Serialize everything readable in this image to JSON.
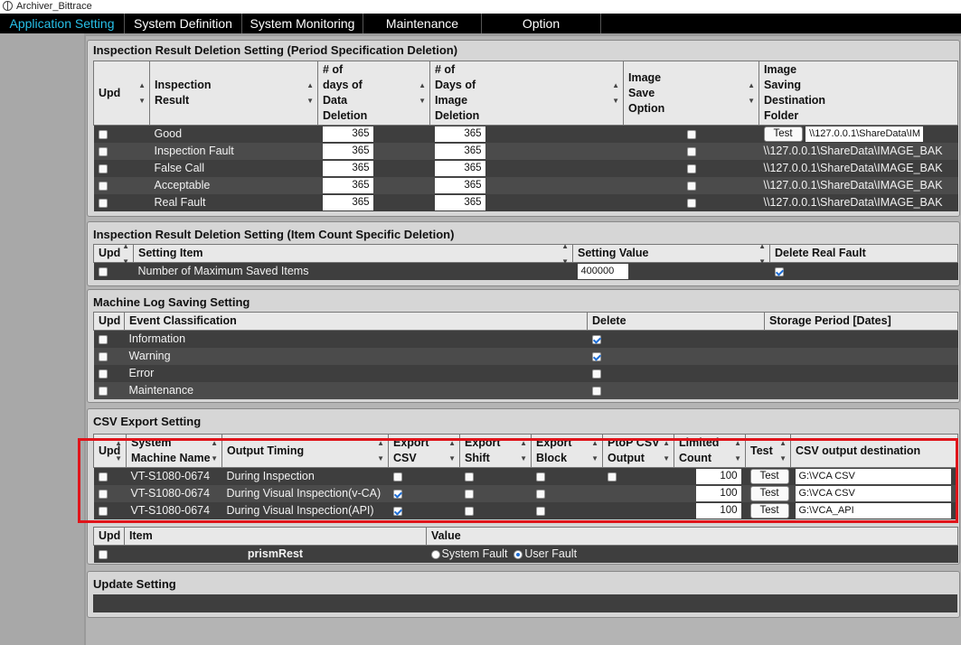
{
  "window": {
    "title": "Archiver_Bittrace"
  },
  "menu": [
    {
      "label": "Application Setting",
      "active": true
    },
    {
      "label": "System Definition"
    },
    {
      "label": "System Monitoring"
    },
    {
      "label": "Maintenance"
    },
    {
      "label": "Option"
    }
  ],
  "period_deletion": {
    "title": "Inspection Result Deletion Setting (Period Specification Deletion)",
    "headers": {
      "upd": "Upd",
      "result": "Inspection\nResult",
      "data_days": "# of\ndays of\nData\nDeletion",
      "image_days": "# of\nDays of\nImage\nDeletion",
      "image_save": "Image\nSave\nOption",
      "folder": "Image\nSaving\nDestination\nFolder"
    },
    "rows": [
      {
        "result": "Good",
        "data_days": "365",
        "image_days": "365",
        "test_label": "Test",
        "folder": "\\\\127.0.0.1\\ShareData\\IM"
      },
      {
        "result": "Inspection Fault",
        "data_days": "365",
        "image_days": "365",
        "folder": "\\\\127.0.0.1\\ShareData\\IMAGE_BAK"
      },
      {
        "result": "False Call",
        "data_days": "365",
        "image_days": "365",
        "folder": "\\\\127.0.0.1\\ShareData\\IMAGE_BAK"
      },
      {
        "result": "Acceptable",
        "data_days": "365",
        "image_days": "365",
        "folder": "\\\\127.0.0.1\\ShareData\\IMAGE_BAK"
      },
      {
        "result": "Real Fault",
        "data_days": "365",
        "image_days": "365",
        "folder": "\\\\127.0.0.1\\ShareData\\IMAGE_BAK"
      }
    ]
  },
  "count_deletion": {
    "title": "Inspection Result Deletion Setting (Item Count Specific Deletion)",
    "headers": {
      "upd": "Upd",
      "item": "Setting Item",
      "value": "Setting Value",
      "delete_real": "Delete Real Fault"
    },
    "rows": [
      {
        "item": "Number of Maximum Saved Items",
        "value": "400000",
        "delete_real": true
      }
    ]
  },
  "machine_log": {
    "title": "Machine Log Saving Setting",
    "headers": {
      "upd": "Upd",
      "event": "Event Classification",
      "delete": "Delete",
      "storage": "Storage Period [Dates]"
    },
    "rows": [
      {
        "event": "Information",
        "delete": true
      },
      {
        "event": "Warning",
        "delete": true
      },
      {
        "event": "Error",
        "delete": false
      },
      {
        "event": "Maintenance",
        "delete": false
      }
    ]
  },
  "csv_export": {
    "title": "CSV Export Setting",
    "headers": {
      "upd": "Upd",
      "machine": "System\nMachine Name",
      "timing": "Output Timing",
      "export_csv": "Export\nCSV",
      "export_shift": "Export\nShift",
      "export_block": "Export\nBlock",
      "ptop": "PtoP CSV\nOutput",
      "limited": "Limited\nCount",
      "test": "Test",
      "dest": "CSV output destination"
    },
    "rows": [
      {
        "machine": "VT-S1080-0674",
        "timing": "During Inspection",
        "export_csv": false,
        "limited": "100",
        "test_label": "Test",
        "dest": "G:\\VCA CSV"
      },
      {
        "machine": "VT-S1080-0674",
        "timing": "During Visual Inspection(v-CA)",
        "export_csv": true,
        "limited": "100",
        "test_label": "Test",
        "dest": "G:\\VCA CSV"
      },
      {
        "machine": "VT-S1080-0674",
        "timing": "During Visual Inspection(API)",
        "export_csv": true,
        "limited": "100",
        "test_label": "Test",
        "dest": "G:\\VCA_API"
      }
    ],
    "sub_headers": {
      "upd": "Upd",
      "item": "Item",
      "value": "Value"
    },
    "sub_row": {
      "item": "prismRest",
      "option_system": "System Fault",
      "option_user": "User Fault",
      "selected": "User Fault"
    }
  },
  "update_setting": {
    "title": "Update Setting"
  }
}
